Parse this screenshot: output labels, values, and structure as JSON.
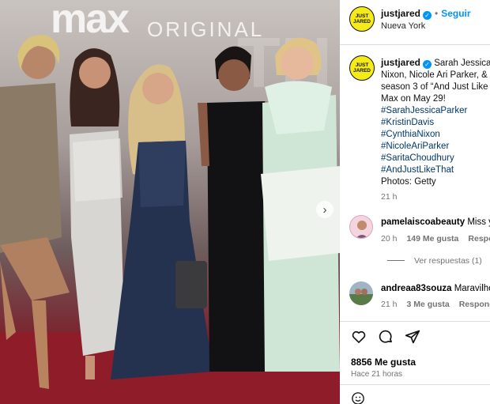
{
  "header": {
    "username": "justjared",
    "follow_label": "Seguir",
    "location": "Nueva York",
    "avatar_text_1": "JUST",
    "avatar_text_2": "JARED"
  },
  "photo": {
    "brand": "max",
    "brand_sub": "ORIGINAL"
  },
  "caption": {
    "username": "justjared",
    "lines": [
      "Sarah Jessica P",
      "Nixon, Nicole Ari Parker, &",
      "season 3 of “And Just Like",
      "Max on May 29!"
    ],
    "hashtags": [
      "#SarahJessicaParker",
      "#KristinDavis",
      "#CynthiaNixon",
      "#NicoleAriParker",
      "#SaritaChoudhury",
      "#AndJustLikeThat"
    ],
    "credit": "Photos: Getty",
    "time": "21 h"
  },
  "comments": [
    {
      "user": "pamelaiscoabeauty",
      "text": "Miss y",
      "time": "20 h",
      "likes": "149 Me gusta",
      "reply": "Respond"
    },
    {
      "user": "andreaa83souza",
      "text": "Maravilho",
      "time": "21 h",
      "likes": "3 Me gusta",
      "reply": "Responder"
    }
  ],
  "view_replies": "Ver respuestas (1)",
  "stats": {
    "likes": "8856 Me gusta",
    "posted": "Hace 21 horas"
  },
  "icons": [
    "heart-icon",
    "comment-icon",
    "share-icon",
    "emoji-icon",
    "chevron-right-icon",
    "verified-icon"
  ],
  "colors": {
    "accent": "#0095f6",
    "avatar_yellow": "#f5ec17",
    "carpet": "#9b1f2b"
  }
}
